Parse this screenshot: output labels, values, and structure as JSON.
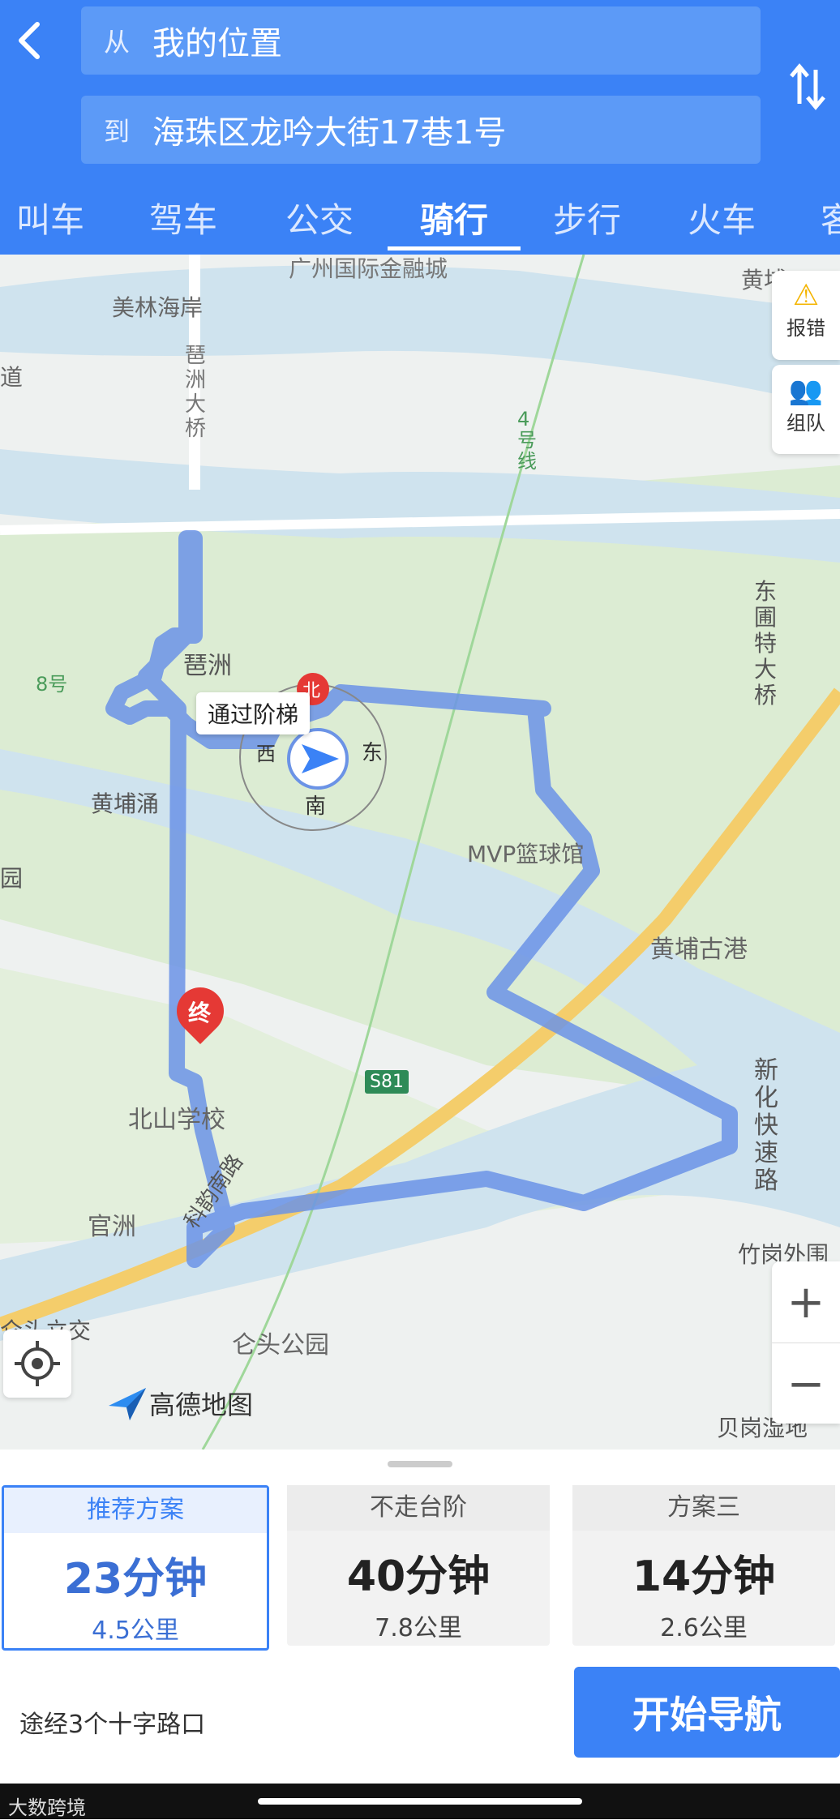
{
  "header": {
    "from_prefix": "从",
    "from_value": "我的位置",
    "to_prefix": "到",
    "to_value": "海珠区龙吟大街17巷1号",
    "tabs": [
      "叫车",
      "驾车",
      "公交",
      "骑行",
      "步行",
      "火车",
      "客"
    ],
    "active_tab": "骑行"
  },
  "map": {
    "labels": {
      "ifc": "广州国际金融城",
      "meilin": "美林海岸",
      "pazhou_bridge": "琶洲大桥",
      "metro4": "4号线",
      "metro8": "8号",
      "dongpu_bridge": "东圃特大桥",
      "pazhou": "琶洲",
      "huangpuchong": "黄埔涌",
      "mvp": "MVP篮球馆",
      "huangpu_port": "黄埔古港",
      "xinhua": "新化快速路",
      "beishan": "北山学校",
      "guanzhou": "官洲",
      "kejuan": "科韵南路",
      "s81": "S81",
      "cangtou_park": "仑头公园",
      "cangtou_jct": "仑头立交",
      "zhugang": "竹岗外围",
      "beigang": "贝岗湿地",
      "huangpu_top": "黄埔",
      "yuan": "园",
      "dao": "道"
    },
    "callout": "通过阶梯",
    "compass": {
      "north": "北",
      "south": "南",
      "east": "东",
      "west": "西"
    },
    "end_marker": "终",
    "report_label": "报错",
    "team_label": "组队",
    "zoom_in": "+",
    "zoom_out": "−",
    "logo_text": "高德地图"
  },
  "plans": [
    {
      "header": "推荐方案",
      "time": "23分钟",
      "distance": "4.5公里",
      "selected": true
    },
    {
      "header": "不走台阶",
      "time": "40分钟",
      "distance": "7.8公里",
      "selected": false
    },
    {
      "header": "方案三",
      "time": "14分钟",
      "distance": "2.6公里",
      "selected": false
    }
  ],
  "via_text": "途经3个十字路口",
  "start_button": "开始导航",
  "watermark": "大数跨境",
  "colors": {
    "accent": "#3b82f6",
    "route": "#6b93e6",
    "end_marker": "#e53935"
  }
}
